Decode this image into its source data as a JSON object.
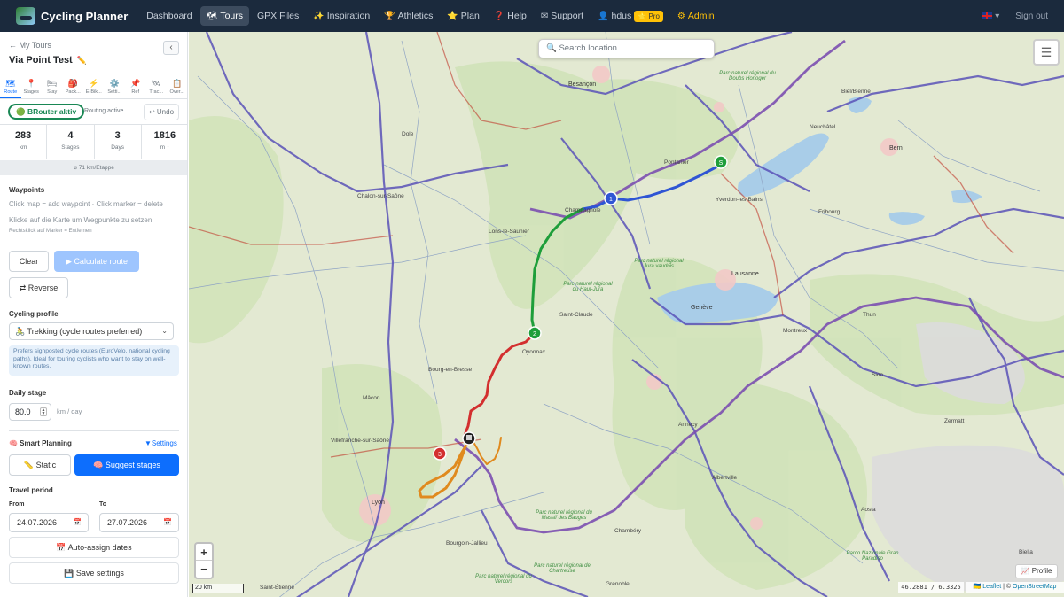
{
  "nav": {
    "brand": "Cycling Planner",
    "items": [
      {
        "icon": "",
        "label": "Dashboard",
        "active": false
      },
      {
        "icon": "🗺",
        "label": "Tours",
        "active": true
      },
      {
        "icon": "",
        "label": "GPX Files",
        "active": false
      },
      {
        "icon": "✨",
        "label": "Inspiration",
        "active": false
      },
      {
        "icon": "🏆",
        "label": "Athletics",
        "active": false
      },
      {
        "icon": "⭐",
        "label": "Plan",
        "active": false
      },
      {
        "icon": "❓",
        "label": "Help",
        "active": false
      },
      {
        "icon": "✉",
        "label": "Support",
        "active": false
      },
      {
        "icon": "👤",
        "label": "hdus",
        "active": false
      },
      {
        "icon": "⚙",
        "label": "Admin",
        "active": false
      }
    ],
    "pro_badge": "⭐ Pro",
    "language_chevron": "▾",
    "sign_out": "Sign out"
  },
  "sidebar": {
    "back_link": "← My Tours",
    "collapse": "‹",
    "tour_title": "Via Point Test",
    "edit_icon": "✏️",
    "tabs": [
      {
        "icon": "🗺",
        "label": "Route",
        "active": true
      },
      {
        "icon": "📍",
        "label": "Stages",
        "active": false
      },
      {
        "icon": "🛏",
        "label": "Stay",
        "active": false
      },
      {
        "icon": "🎒",
        "label": "Pack...",
        "active": false
      },
      {
        "icon": "⚡",
        "label": "E-Bik...",
        "active": false
      },
      {
        "icon": "⚙️",
        "label": "Setti...",
        "active": false
      },
      {
        "icon": "📌",
        "label": "Ref",
        "active": false
      },
      {
        "icon": "🛰",
        "label": "Trac...",
        "active": false
      },
      {
        "icon": "📋",
        "label": "Over...",
        "active": false
      }
    ],
    "brouter_badge": "🟢 BRouter aktiv",
    "routing_status": "Routing active",
    "undo": "↩ Undo",
    "stats": [
      {
        "value": "283",
        "unit": "km"
      },
      {
        "value": "4",
        "unit": "Stages"
      },
      {
        "value": "3",
        "unit": "Days"
      },
      {
        "value": "1816",
        "unit": "m ↑"
      }
    ],
    "per_stage": "⌀ 71 km/Etappe",
    "waypoints_heading": "Waypoints",
    "waypoints_hint": "Click map = add waypoint · Click marker = delete",
    "waypoints_hint_de": "Klicke auf die Karte um Wegpunkte zu setzen.",
    "waypoints_hint_small": "Rechtsklick auf Marker = Entfernen",
    "clear_button": "Clear",
    "calculate_button": "▶ Calculate route",
    "reverse_button": "⇄ Reverse",
    "profile_heading": "Cycling profile",
    "profile_value": "🚴 Trekking (cycle routes preferred)",
    "profile_info": "Prefers signposted cycle routes (EuroVelo, national cycling paths). Ideal for touring cyclists who want to stay on well-known routes.",
    "daily_stage_heading": "Daily stage",
    "daily_stage_value": "80.0",
    "daily_stage_unit": "km / day",
    "smart_planning_heading": "🧠 Smart Planning",
    "settings_link": "▼Settings",
    "static_button": "📏 Static",
    "suggest_button": "🧠 Suggest stages",
    "travel_period_heading": "Travel period",
    "from_label": "From",
    "to_label": "To",
    "from_date": "24.07.2026",
    "to_date": "27.07.2026",
    "auto_assign_button": "📅 Auto-assign dates",
    "save_settings_button": "💾 Save settings"
  },
  "map": {
    "search_placeholder": "🔍 Search location...",
    "zoom_in": "+",
    "zoom_out": "−",
    "scale": "20 km",
    "profile_button": "📈 Profile",
    "coords": "46.2881 / 6.3325",
    "attribution_leaflet": "🇺🇦 Leaflet",
    "attribution_sep": " | © ",
    "attribution_osm": "OpenStreetMap",
    "markers": [
      "1",
      "2",
      "3",
      "S"
    ],
    "route_colors": {
      "stage1": "#2f55d4",
      "stage2": "#1e9e3a",
      "stage3": "#d32f2f",
      "stage4": "#e08a1e"
    },
    "places": [
      {
        "name": "Besançon",
        "cls": "big"
      },
      {
        "name": "Lons-le-Saunier",
        "cls": "city"
      },
      {
        "name": "Bourg-en-Bresse",
        "cls": "city"
      },
      {
        "name": "Lyon",
        "cls": "big"
      },
      {
        "name": "Genève",
        "cls": "big"
      },
      {
        "name": "Lausanne",
        "cls": "big"
      },
      {
        "name": "Bern",
        "cls": "big"
      },
      {
        "name": "Biel/Bienne",
        "cls": "city"
      },
      {
        "name": "Neuchâtel",
        "cls": "city"
      },
      {
        "name": "Yverdon-les-Bains",
        "cls": "city"
      },
      {
        "name": "Pontarlier",
        "cls": "city"
      },
      {
        "name": "Champagnole",
        "cls": "city"
      },
      {
        "name": "Saint-Claude",
        "cls": "city"
      },
      {
        "name": "Oyonnax",
        "cls": "city"
      },
      {
        "name": "Annecy",
        "cls": "city"
      },
      {
        "name": "Chambéry",
        "cls": "city"
      },
      {
        "name": "Grenoble",
        "cls": "city"
      },
      {
        "name": "Saint-Étienne",
        "cls": "city"
      },
      {
        "name": "Thun",
        "cls": "city"
      },
      {
        "name": "Fribourg",
        "cls": "city"
      },
      {
        "name": "Zermatt",
        "cls": "city"
      },
      {
        "name": "Aosta",
        "cls": "city"
      },
      {
        "name": "Biella",
        "cls": "city"
      },
      {
        "name": "Dole",
        "cls": "city"
      },
      {
        "name": "Chalon-sur-Saône",
        "cls": "city"
      },
      {
        "name": "Mâcon",
        "cls": "city"
      },
      {
        "name": "Villefranche-sur-Saône",
        "cls": "city"
      },
      {
        "name": "Bourgoin-Jallieu",
        "cls": "city"
      },
      {
        "name": "Montreux",
        "cls": "city"
      },
      {
        "name": "Sion",
        "cls": "city"
      },
      {
        "name": "Albertville",
        "cls": "city"
      }
    ],
    "parks": [
      "Parc naturel régional du Doubs Horloger",
      "Parc naturel régional du Haut-Jura",
      "Parc naturel régional Jura vaudois",
      "Parc naturel régional du Massif des Bauges",
      "Parco Nazionale Gran Paradiso",
      "Parc naturel régional de Chartreuse",
      "Parc naturel régional du Vercors"
    ]
  }
}
